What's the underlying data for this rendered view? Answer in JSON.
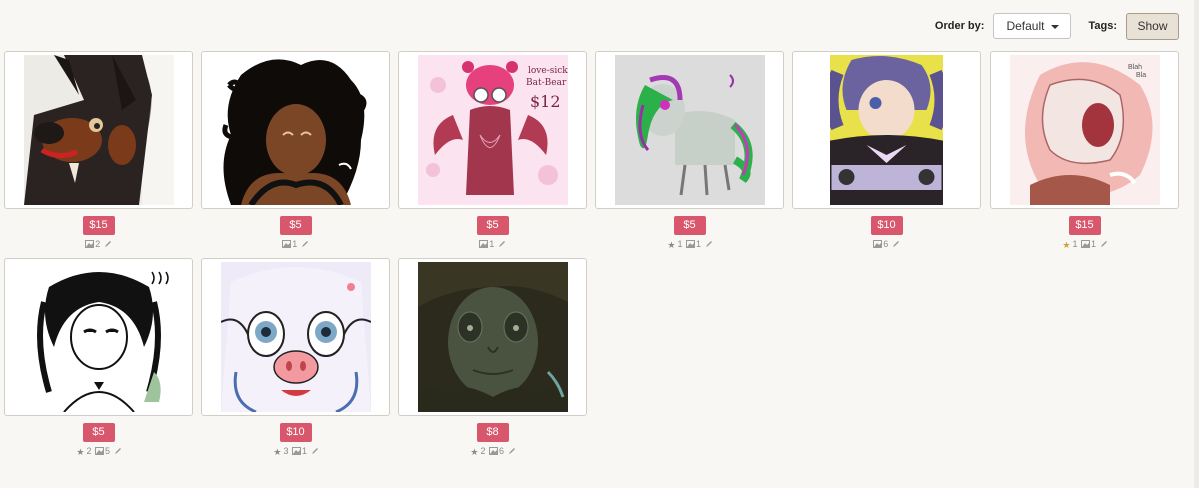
{
  "toolbar": {
    "order_label": "Order by:",
    "order_value": "Default",
    "tags_label": "Tags:",
    "show_label": "Show"
  },
  "items": [
    {
      "price": "$15",
      "favorites": "",
      "images": "2"
    },
    {
      "price": "$5",
      "favorites": "",
      "images": "1"
    },
    {
      "price": "$5",
      "favorites": "",
      "images": "1"
    },
    {
      "price": "$5",
      "favorites": "1",
      "images": "1"
    },
    {
      "price": "$10",
      "favorites": "",
      "images": "6"
    },
    {
      "price": "$15",
      "favorites": "1",
      "images": "1"
    },
    {
      "price": "$5",
      "favorites": "2",
      "images": "5"
    },
    {
      "price": "$10",
      "favorites": "3",
      "images": "1"
    },
    {
      "price": "$8",
      "favorites": "2",
      "images": "6"
    }
  ],
  "artwork_text": {
    "item3_lines": [
      "love-sick",
      "Bat-Bear",
      "$12"
    ],
    "item6_lines": [
      "Blah",
      "Bla"
    ]
  }
}
